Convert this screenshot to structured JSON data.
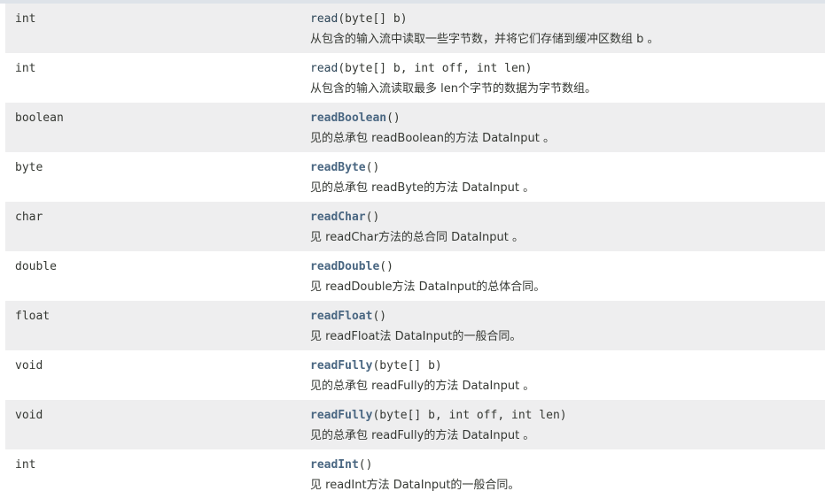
{
  "rows": [
    {
      "type": "int",
      "name": "read",
      "params": "(byte[] b)",
      "desc": "从包含的输入流中读取一些字节数，并将它们存储到缓冲区数组 b 。"
    },
    {
      "type": "int",
      "name": "read",
      "params": "(byte[] b, int off, int len)",
      "desc": "从包含的输入流读取最多 len个字节的数据为字节数组。"
    },
    {
      "type": "boolean",
      "name": "readBoolean",
      "params": "()",
      "desc": "见的总承包 readBoolean的方法 DataInput 。"
    },
    {
      "type": "byte",
      "name": "readByte",
      "params": "()",
      "desc": "见的总承包 readByte的方法 DataInput 。"
    },
    {
      "type": "char",
      "name": "readChar",
      "params": "()",
      "desc": "见 readChar方法的总合同 DataInput 。"
    },
    {
      "type": "double",
      "name": "readDouble",
      "params": "()",
      "desc": "见 readDouble方法 DataInput的总体合同。"
    },
    {
      "type": "float",
      "name": "readFloat",
      "params": "()",
      "desc": "见 readFloat法 DataInput的一般合同。"
    },
    {
      "type": "void",
      "name": "readFully",
      "params": "(byte[] b)",
      "desc": "见的总承包 readFully的方法 DataInput 。"
    },
    {
      "type": "void",
      "name": "readFully",
      "params": "(byte[] b, int off, int len)",
      "desc": "见的总承包 readFully的方法 DataInput 。"
    },
    {
      "type": "int",
      "name": "readInt",
      "params": "()",
      "desc": "见 readInt方法 DataInput的一般合同。"
    }
  ]
}
